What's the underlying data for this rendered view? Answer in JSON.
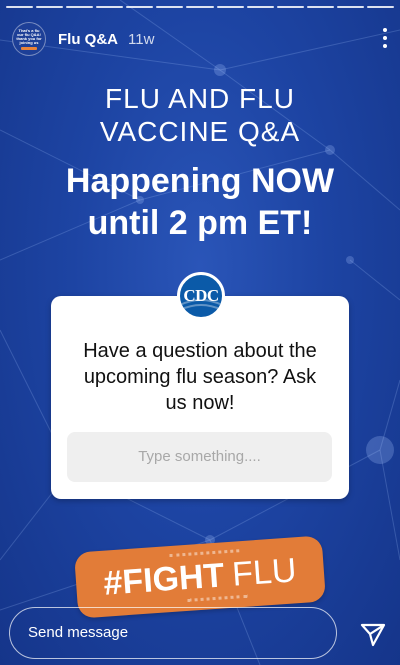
{
  "header": {
    "avatar_text": [
      "That's a flu",
      "our flu Q&A!",
      "thank you for",
      "joining us"
    ],
    "account_name": "Flu Q&A",
    "time_ago": "11w"
  },
  "story": {
    "title_line1": "FLU AND FLU",
    "title_line2": "VACCINE Q&A",
    "headline_line1": "Happening NOW",
    "headline_line2": "until 2 pm ET!"
  },
  "question_card": {
    "logo_text": "CDC",
    "question_line1": "Have a question about the",
    "question_line2": "upcoming flu season? Ask",
    "question_line3": "us now!",
    "answer_placeholder": "Type something...."
  },
  "sticker": {
    "strong": "#FIGHT",
    "light": "FLU"
  },
  "reply": {
    "placeholder": "Send message"
  },
  "icons": {
    "more": "more-vertical-icon",
    "send": "paper-plane-icon"
  },
  "colors": {
    "background": "#1d44a3",
    "sticker": "#e27c38",
    "cdc_blue": "#0b5aa8"
  }
}
